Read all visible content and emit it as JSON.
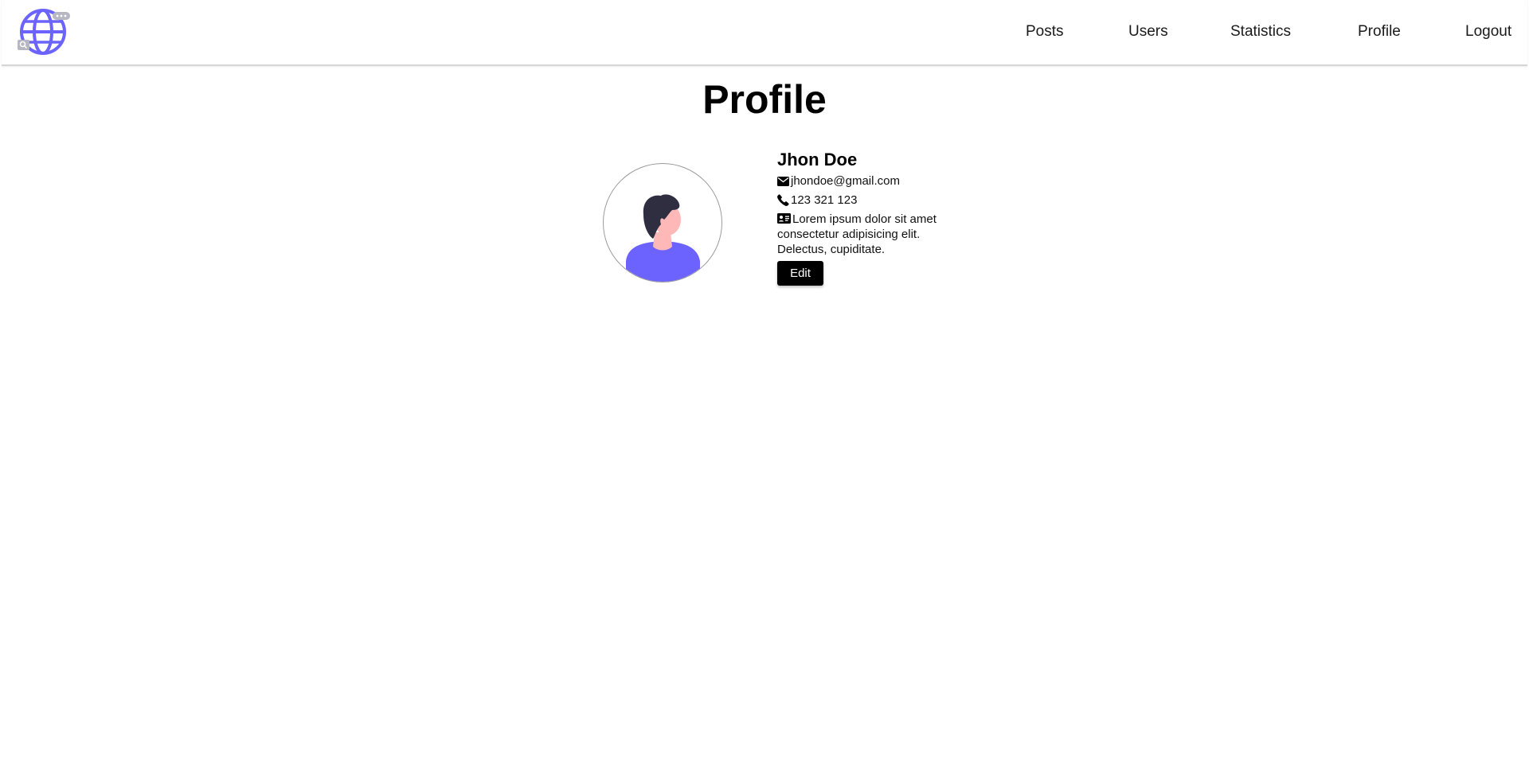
{
  "nav": {
    "logo_icon": "globe-chat-search-icon",
    "links": [
      {
        "label": "Posts"
      },
      {
        "label": "Users"
      },
      {
        "label": "Statistics"
      },
      {
        "label": "Profile"
      },
      {
        "label": "Logout"
      }
    ]
  },
  "page": {
    "title": "Profile"
  },
  "profile": {
    "avatar_icon": "person-avatar-icon",
    "name": "Jhon Doe",
    "email": "jhondoe@gmail.com",
    "email_icon": "envelope-icon",
    "phone": "123 321 123",
    "phone_icon": "phone-icon",
    "bio": "Lorem ipsum dolor sit amet consectetur adipisicing elit. Delectus, cupiditate.",
    "bio_icon": "id-card-icon",
    "edit_label": "Edit"
  },
  "colors": {
    "accent": "#6c63ff",
    "button_bg": "#000000",
    "button_text": "#ffffff"
  }
}
